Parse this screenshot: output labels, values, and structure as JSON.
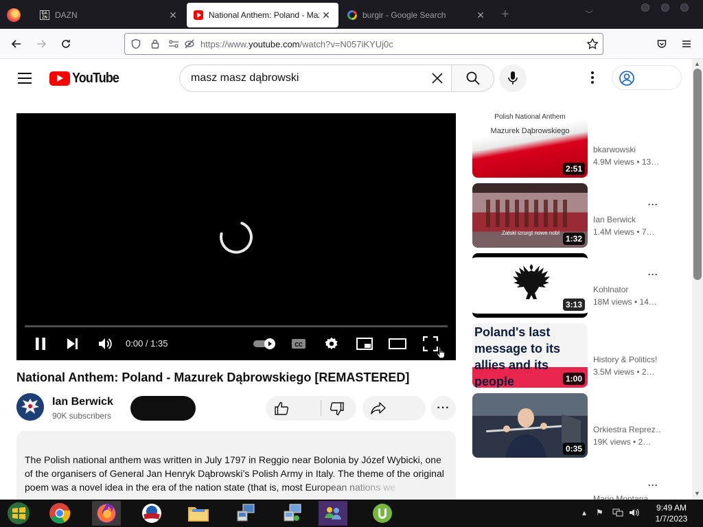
{
  "browser": {
    "tabs": [
      {
        "title": "DAZN",
        "favicon": "dazn-icon"
      },
      {
        "title": "National Anthem: Poland - Mazurek Dąbrowskiego",
        "favicon": "youtube-icon",
        "active": true
      },
      {
        "title": "burgir - Google Search",
        "favicon": "google-icon"
      }
    ],
    "url_prefix": "https://www.",
    "url_domain": "youtube.com",
    "url_path": "/watch?v=N057iKYUj0c"
  },
  "youtube": {
    "logo_text": "YouTube",
    "search_query": "masz masz dąbrowski"
  },
  "player": {
    "time": "0:00 / 1:35",
    "progress_fraction": 0
  },
  "video": {
    "title": "National Anthem: Poland - Mazurek Dąbrowskiego [REMASTERED]",
    "channel": "Ian Berwick",
    "subscribers": "90K subscribers",
    "description": "The Polish national anthem was written in July 1797 in Reggio near Bolonia by Józef Wybicki, one of the organisers of General Jan Henryk Dąbrowski’s Polish Army in Italy. The theme of the original poem was a novel idea in the era of the nation state (that is, most European nations we"
  },
  "recommendations": [
    {
      "channel": "bkarwowski",
      "meta": "4.9M views • 13…",
      "duration": "2:51",
      "thumb_line1": "Polish National Anthem",
      "thumb_line2": "Mazurek Dąbrowskiego"
    },
    {
      "channel": "Ian Berwick",
      "meta": "1.4M views • 7…",
      "duration": "1:32",
      "thumb_line1": "Zalskl izrurgt nowe nobl",
      "thumb_line2": ""
    },
    {
      "channel": "Kohlnator",
      "meta": "18M views • 14…",
      "duration": "3:13",
      "thumb_line1": "",
      "thumb_line2": ""
    },
    {
      "channel": "History & Politics!",
      "meta": "3.5M views • 2…",
      "duration": "1:00",
      "thumb_line1": "Poland's last message to its",
      "thumb_line2": "allies and its people"
    },
    {
      "channel": "Orkiestra Reprez…",
      "meta": "19K views • 2…",
      "duration": "0:35",
      "thumb_line1": "",
      "thumb_line2": ""
    },
    {
      "channel": "Mario Montana",
      "meta": "",
      "duration": "",
      "thumb_line1": "",
      "thumb_line2": ""
    }
  ],
  "taskbar": {
    "clock_time": "9:49 AM",
    "clock_date": "1/7/2023"
  }
}
